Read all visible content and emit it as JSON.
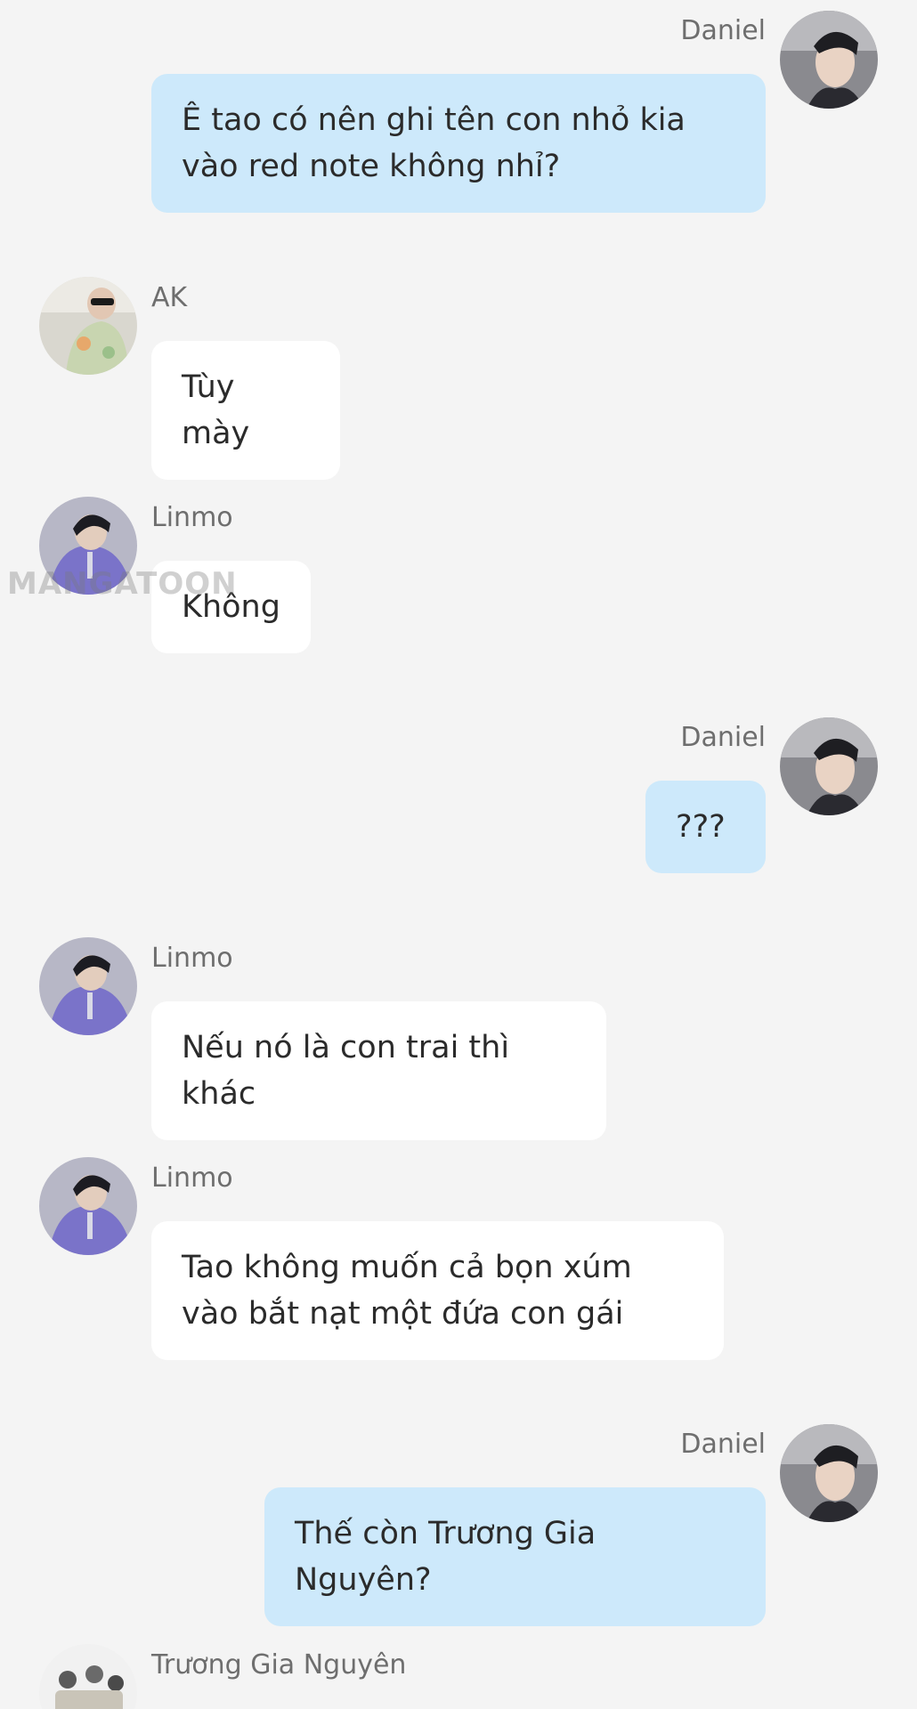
{
  "colors": {
    "background": "#f4f4f4",
    "my_bubble": "#cde9fb",
    "their_bubble": "#ffffff",
    "sender_name": "#6e6e6e",
    "text": "#2b2b2b"
  },
  "watermark": "MANGATOON",
  "messages": [
    {
      "side": "right",
      "sender": "Daniel",
      "text": "Ê tao có nên ghi tên con nhỏ kia vào red note không nhỉ?"
    },
    {
      "side": "left",
      "sender": "AK",
      "text": "Tùy mày"
    },
    {
      "side": "left",
      "sender": "Linmo",
      "text": "Không"
    },
    {
      "side": "right",
      "sender": "Daniel",
      "text": "???"
    },
    {
      "side": "left",
      "sender": "Linmo",
      "text": "Nếu nó là con trai thì khác"
    },
    {
      "side": "left",
      "sender": "Linmo",
      "text": "Tao không muốn cả bọn xúm vào bắt nạt một đứa con gái"
    },
    {
      "side": "right",
      "sender": "Daniel",
      "text": "Thế còn Trương Gia Nguyên?"
    },
    {
      "side": "left",
      "sender": "Trương Gia Nguyên",
      "text": ""
    }
  ]
}
